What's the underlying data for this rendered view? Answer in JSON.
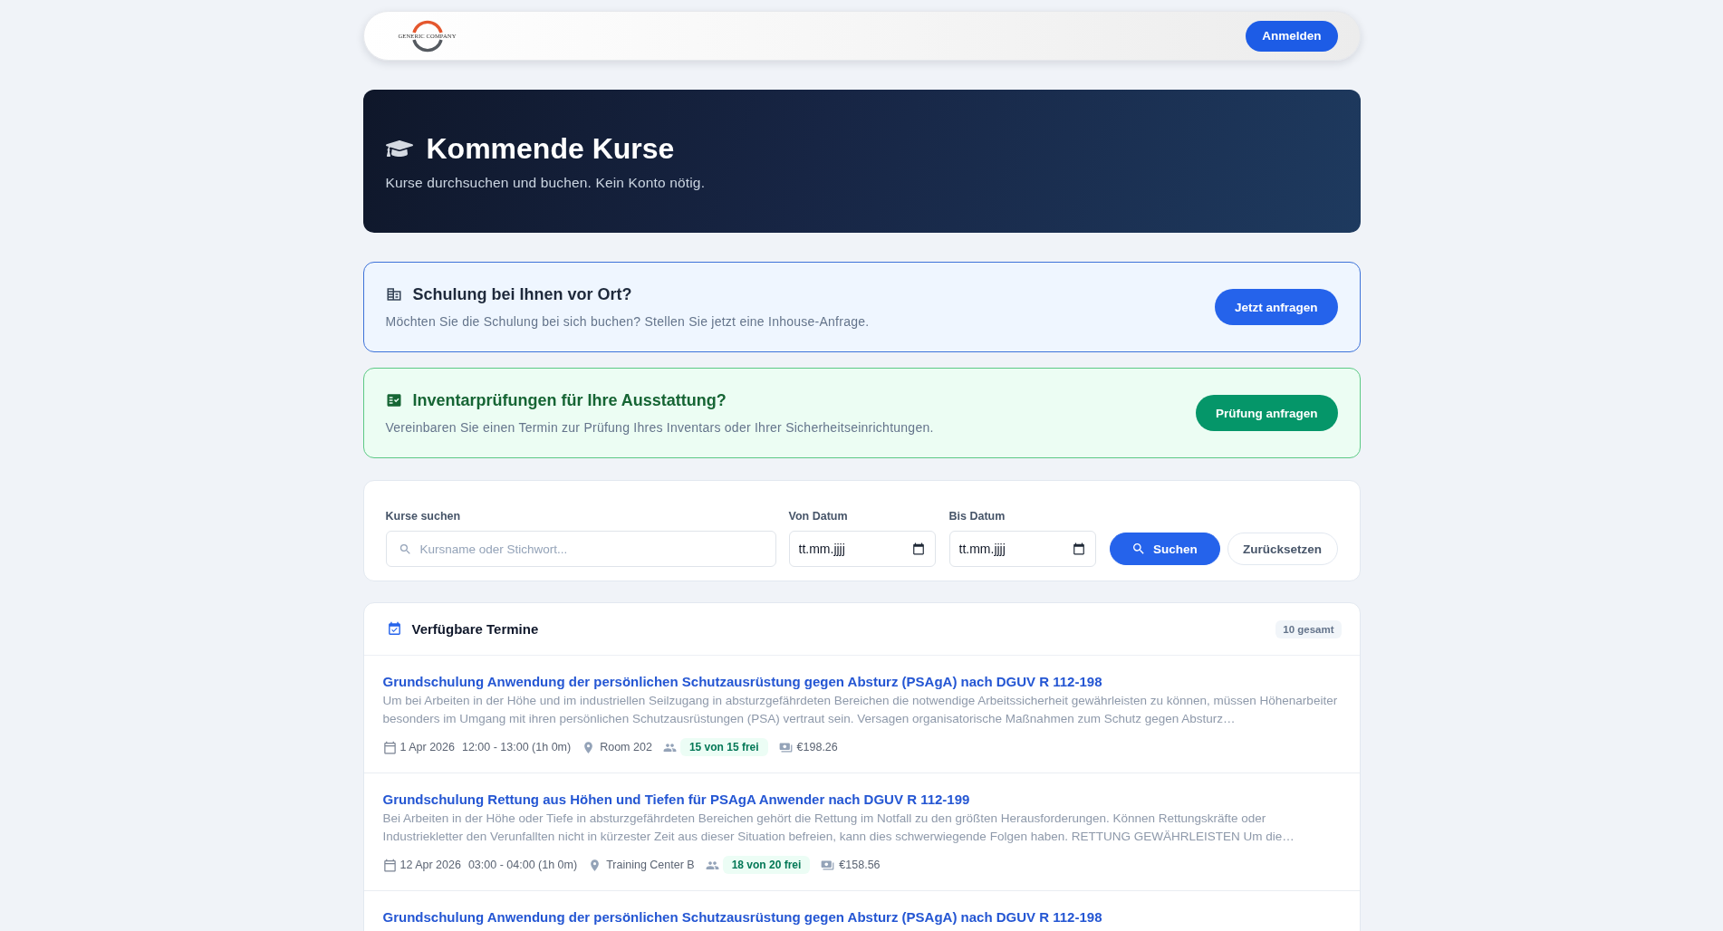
{
  "navbar": {
    "logo_text": "GENERIC COMPANY",
    "login_button": "Anmelden"
  },
  "hero": {
    "title": "Kommende Kurse",
    "subtitle": "Kurse durchsuchen und buchen. Kein Konto nötig."
  },
  "banners": [
    {
      "kind": "inhouse",
      "title": "Schulung bei Ihnen vor Ort?",
      "text": "Möchten Sie die Schulung bei sich buchen? Stellen Sie jetzt eine Inhouse-Anfrage.",
      "button": "Jetzt anfragen"
    },
    {
      "kind": "inventory",
      "title": "Inventarprüfungen für Ihre Ausstattung?",
      "text": "Vereinbaren Sie einen Termin zur Prüfung Ihres Inventars oder Ihrer Sicherheitseinrichtungen.",
      "button": "Prüfung anfragen"
    }
  ],
  "search": {
    "fields": [
      {
        "kind": "text",
        "label": "Kurse suchen",
        "placeholder": "Kursname oder Stichwort..."
      },
      {
        "kind": "date",
        "label": "Von Datum",
        "placeholder": "tt.mm.jjjj"
      },
      {
        "kind": "date",
        "label": "Bis Datum",
        "placeholder": "tt.mm.jjjj"
      }
    ],
    "buttons": [
      {
        "kind": "primary",
        "label": "Suchen"
      },
      {
        "kind": "secondary",
        "label": "Zurücksetzen"
      }
    ]
  },
  "courses": {
    "title": "Verfügbare Termine",
    "count": "10 gesamt",
    "items": [
      {
        "title": "Grundschulung Anwendung der persönlichen Schutzausrüstung gegen Absturz (PSAgA) nach DGUV R 112-198",
        "description": "Um bei Arbeiten in der Höhe und im industriellen Seilzugang in absturzgefährdeten Bereichen die notwendige Arbeitssicherheit gewährleisten zu können, müssen Höhenarbeiter besonders im Umgang mit ihren persönlichen Schutzausrüstungen (PSA) vertraut sein. Versagen organisatorische Maßnahmen zum Schutz gegen Absturz…",
        "date": "1 Apr 2026",
        "time": "12:00 - 13:00 (1h 0m)",
        "location": "Room 202",
        "seats": "15 von 15 frei",
        "price": "€198.26"
      },
      {
        "title": "Grundschulung Rettung aus Höhen und Tiefen für PSAgA Anwender nach DGUV R 112-199",
        "description": "Bei Arbeiten in der Höhe oder Tiefe in absturzgefährdeten Bereichen gehört die Rettung im Notfall zu den größten Herausforderungen. Können Rettungskräfte oder Industriekletter den Verunfallten nicht in kürzester Zeit aus dieser Situation befreien, kann dies schwerwiegende Folgen haben. RETTUNG GEWÄHRLEISTEN Um die…",
        "date": "12 Apr 2026",
        "time": "03:00 - 04:00 (1h 0m)",
        "location": "Training Center B",
        "seats": "18 von 20 frei",
        "price": "€158.56"
      },
      {
        "title": "Grundschulung Anwendung der persönlichen Schutzausrüstung gegen Absturz (PSAgA) nach DGUV R 112-198"
      }
    ]
  }
}
